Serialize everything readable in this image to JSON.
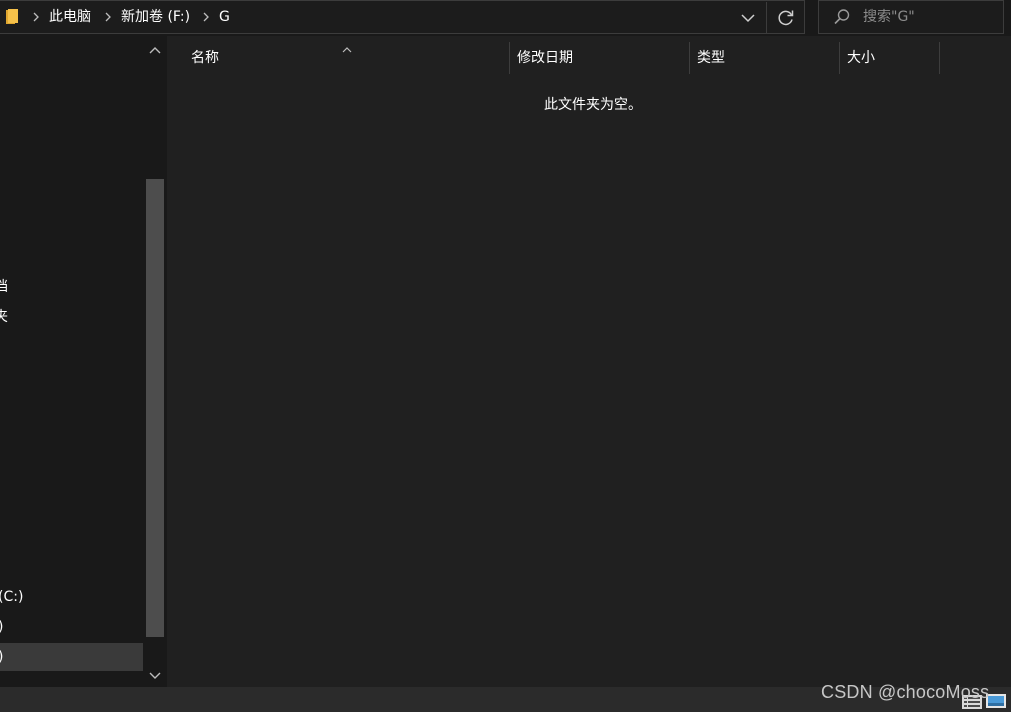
{
  "address_bar": {
    "breadcrumbs": [
      {
        "label": "此电脑"
      },
      {
        "label": "新加卷 (F:)"
      },
      {
        "label": "G"
      }
    ]
  },
  "search": {
    "placeholder": "搜索\"G\""
  },
  "nav_pane": {
    "items": [
      {
        "label": "档",
        "selected": false
      },
      {
        "label": "夹",
        "selected": false
      },
      {
        "label": "(C:)",
        "selected": false
      },
      {
        "label": ")",
        "selected": false
      },
      {
        "label": ")",
        "selected": true
      }
    ]
  },
  "columns": [
    {
      "label": "名称"
    },
    {
      "label": "修改日期"
    },
    {
      "label": "类型"
    },
    {
      "label": "大小"
    }
  ],
  "content": {
    "empty_message": "此文件夹为空。"
  },
  "watermark": "CSDN @chocoMoss",
  "colors": {
    "background": "#191919",
    "content_background": "#202020",
    "selected_item": "#3a3a3a",
    "scroll_thumb": "#4d4d4d",
    "status_bar": "#2b2b2b",
    "folder_icon": "#f5c14a",
    "view_icon_accent": "#4a9ad8"
  },
  "icons": {
    "folder": "folder-icon",
    "breadcrumb_separator": "chevron-right-icon",
    "dropdown": "chevron-down-icon",
    "refresh": "refresh-icon",
    "search": "search-icon",
    "sort": "sort-ascending-icon",
    "scroll_up": "chevron-up-icon",
    "scroll_down": "chevron-down-icon",
    "view_details": "details-view-icon",
    "view_tiles": "large-icons-view-icon"
  }
}
